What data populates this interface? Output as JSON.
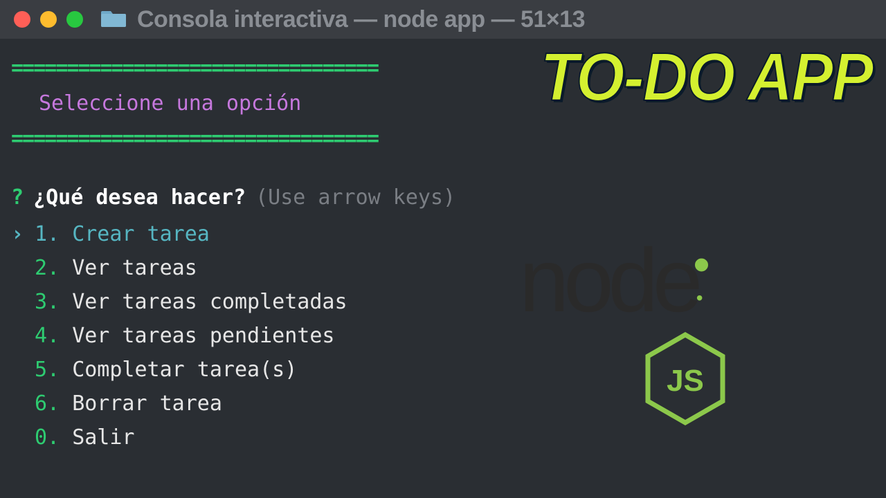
{
  "titlebar": {
    "title": "Consola interactiva — node app — 51×13"
  },
  "terminal": {
    "divider": "=================================",
    "header": "Seleccione una opción",
    "prompt_mark": "?",
    "prompt": "¿Qué desea hacer?",
    "hint": "(Use arrow keys)",
    "pointer": "›",
    "menu": [
      {
        "num": "1.",
        "label": "Crear tarea",
        "selected": true
      },
      {
        "num": "2.",
        "label": "Ver tareas",
        "selected": false
      },
      {
        "num": "3.",
        "label": "Ver tareas completadas",
        "selected": false
      },
      {
        "num": "4.",
        "label": "Ver tareas pendientes",
        "selected": false
      },
      {
        "num": "5.",
        "label": "Completar tarea(s)",
        "selected": false
      },
      {
        "num": "6.",
        "label": "Borrar tarea",
        "selected": false
      },
      {
        "num": "0.",
        "label": "Salir",
        "selected": false
      }
    ]
  },
  "overlay": {
    "title": "TO-DO APP",
    "logo_text": "node",
    "logo_sub": "JS"
  },
  "colors": {
    "green": "#2ecc71",
    "cyan": "#56b6c2",
    "purple": "#c678dd",
    "node_green": "#8cc84b",
    "overlay_yellow": "#d4f030"
  }
}
